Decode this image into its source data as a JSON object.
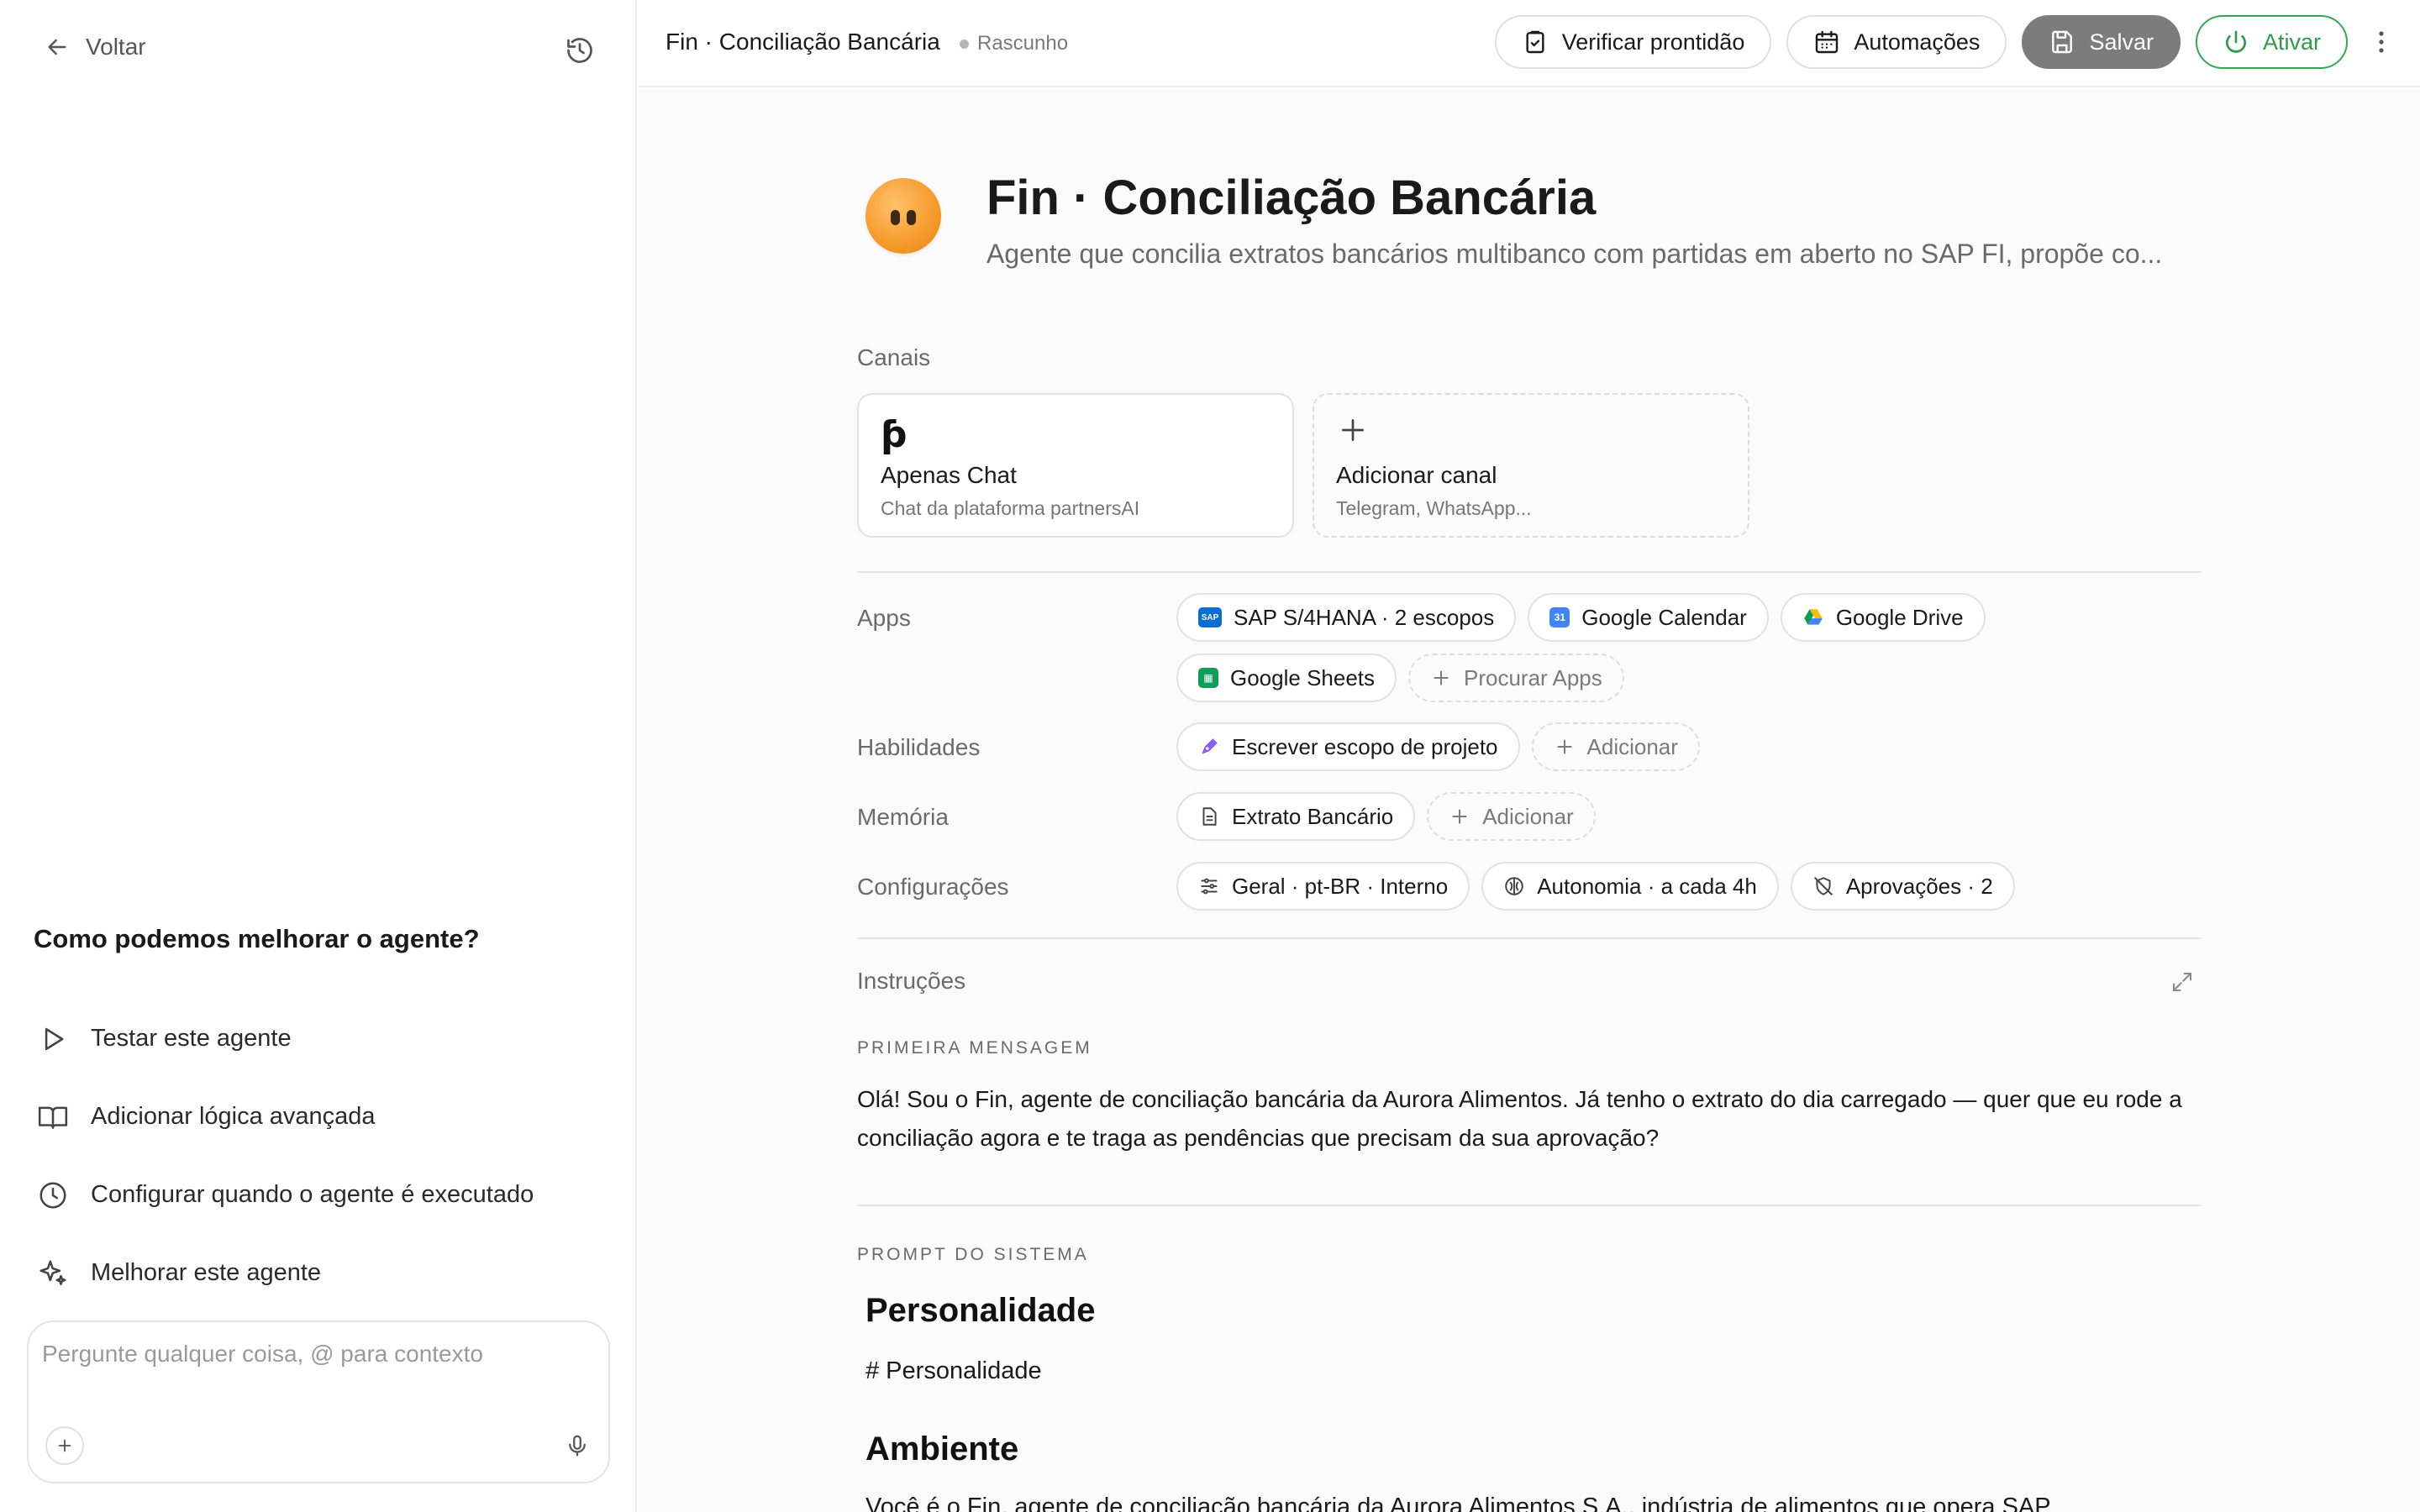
{
  "sidebar": {
    "back_label": "Voltar",
    "improve_title": "Como podemos melhorar o agente?",
    "items": [
      {
        "label": "Testar este agente",
        "icon": "play-icon"
      },
      {
        "label": "Adicionar lógica avançada",
        "icon": "book-icon"
      },
      {
        "label": "Configurar quando o agente é executado",
        "icon": "clock-icon"
      },
      {
        "label": "Melhorar este agente",
        "icon": "sparkle-icon"
      }
    ],
    "chat_placeholder": "Pergunte qualquer coisa, @ para contexto"
  },
  "topbar": {
    "title": "Fin · Conciliação Bancária",
    "status": "Rascunho",
    "buttons": {
      "verify": "Verificar prontidão",
      "automations": "Automações",
      "save": "Salvar",
      "activate": "Ativar"
    }
  },
  "agent": {
    "name": "Fin · Conciliação Bancária",
    "description": "Agente que concilia extratos bancários multibanco com partidas em aberto no SAP FI, propõe co..."
  },
  "channels": {
    "label": "Canais",
    "items": [
      {
        "title": "Apenas Chat",
        "subtitle": "Chat da plataforma partnersAI"
      },
      {
        "title": "Adicionar canal",
        "subtitle": "Telegram, WhatsApp..."
      }
    ]
  },
  "apps": {
    "label": "Apps",
    "items": [
      {
        "label": "SAP S/4HANA · 2 escopos",
        "icon": "sap-icon"
      },
      {
        "label": "Google Calendar",
        "icon": "google-calendar-icon"
      },
      {
        "label": "Google Drive",
        "icon": "google-drive-icon"
      },
      {
        "label": "Google Sheets",
        "icon": "google-sheets-icon"
      }
    ],
    "search_label": "Procurar Apps"
  },
  "skills": {
    "label": "Habilidades",
    "items": [
      {
        "label": "Escrever escopo de projeto",
        "icon": "pen-icon"
      }
    ],
    "add_label": "Adicionar"
  },
  "memory": {
    "label": "Memória",
    "items": [
      {
        "label": "Extrato Bancário",
        "icon": "document-icon"
      }
    ],
    "add_label": "Adicionar"
  },
  "settings": {
    "label": "Configurações",
    "items": [
      {
        "label": "Geral · pt-BR · Interno",
        "icon": "sliders-icon"
      },
      {
        "label": "Autonomia · a cada 4h",
        "icon": "autonomy-icon"
      },
      {
        "label": "Aprovações · 2",
        "icon": "approval-icon"
      }
    ]
  },
  "instructions": {
    "title": "Instruções",
    "first_message_label": "PRIMEIRA MENSAGEM",
    "first_message": "Olá! Sou o Fin, agente de conciliação bancária da Aurora Alimentos. Já tenho o extrato do dia carregado — quer que eu rode a conciliação agora e te traga as pendências que precisam da sua aprovação?",
    "system_prompt_label": "PROMPT DO SISTEMA",
    "prompt_heading_1": "Personalidade",
    "prompt_text_1": "# Personalidade",
    "prompt_heading_2": "Ambiente",
    "prompt_text_2": "Você é o Fin, agente de conciliação bancária da Aurora Alimentos S.A., indústria de alimentos que opera SAP"
  },
  "colors": {
    "accent_green": "#2f9a4d",
    "save_gray": "#7c7c7c",
    "avatar_orange": "#f59a2c"
  }
}
